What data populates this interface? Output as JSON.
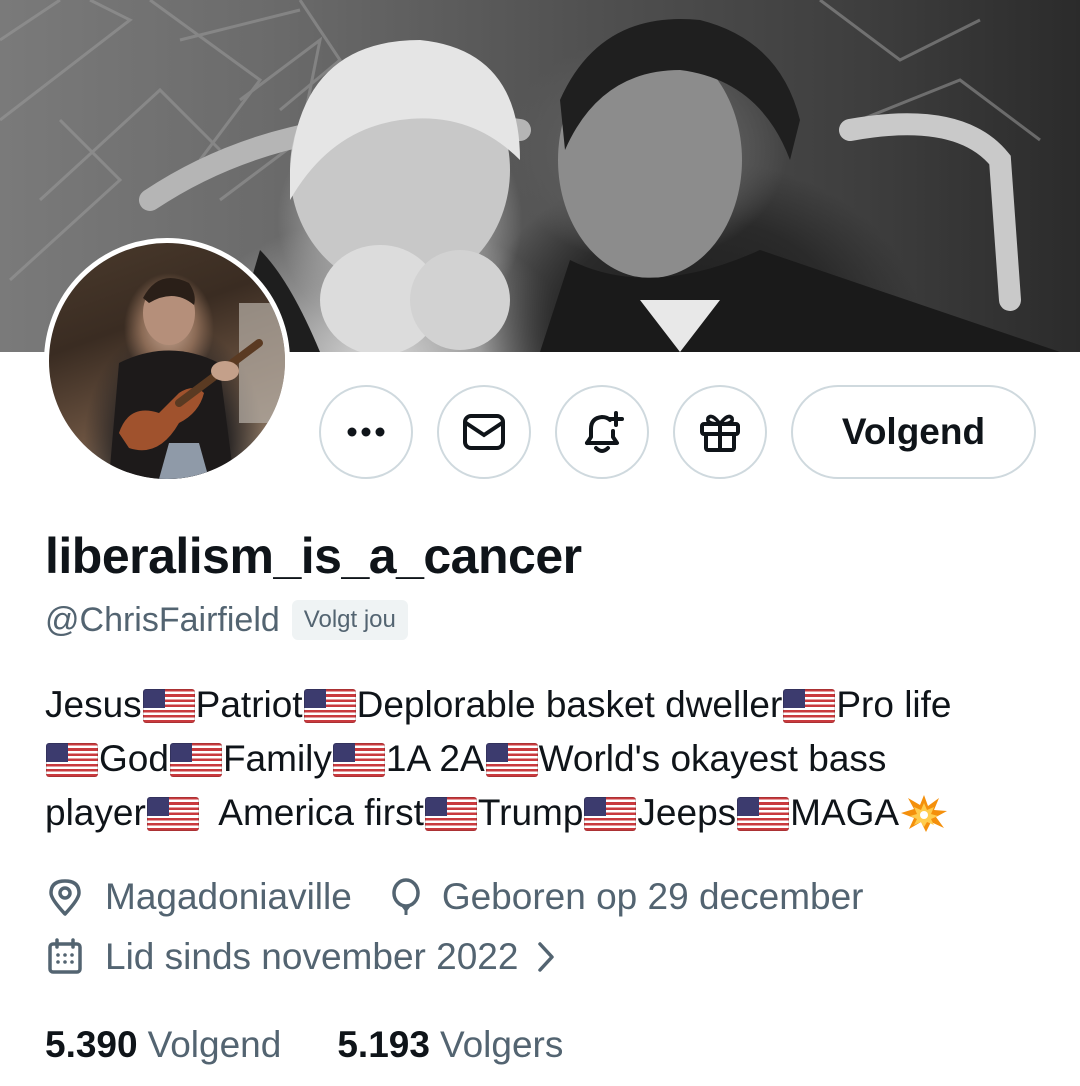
{
  "profile": {
    "display_name": "liberalism_is_a_cancer",
    "handle": "@ChrisFairfield",
    "follows_you": "Volgt jou",
    "bio_segments": [
      {
        "t": "text",
        "v": "Jesus"
      },
      {
        "t": "flag"
      },
      {
        "t": "text",
        "v": "Patriot"
      },
      {
        "t": "flag"
      },
      {
        "t": "text",
        "v": "Deplorable basket dweller"
      },
      {
        "t": "flag"
      },
      {
        "t": "text",
        "v": "Pro life\n"
      },
      {
        "t": "flag"
      },
      {
        "t": "text",
        "v": "God"
      },
      {
        "t": "flag"
      },
      {
        "t": "text",
        "v": "Family"
      },
      {
        "t": "flag"
      },
      {
        "t": "text",
        "v": "1A 2A"
      },
      {
        "t": "flag"
      },
      {
        "t": "text",
        "v": "World's okayest bass\nplayer"
      },
      {
        "t": "flag"
      },
      {
        "t": "text",
        "v": "  America first"
      },
      {
        "t": "flag"
      },
      {
        "t": "text",
        "v": "Trump"
      },
      {
        "t": "flag"
      },
      {
        "t": "text",
        "v": "Jeeps"
      },
      {
        "t": "flag"
      },
      {
        "t": "text",
        "v": "MAGA"
      },
      {
        "t": "boom"
      }
    ],
    "location": "Magadoniaville",
    "birthday": "Geboren op 29 december",
    "joined": "Lid sinds november 2022",
    "following_count": "5.390",
    "following_label": "Volgend",
    "followers_count": "5.193",
    "followers_label": "Volgers"
  },
  "actions": {
    "follow_button_label": "Volgend",
    "icons": [
      "more-icon",
      "message-icon",
      "notification-bell-icon",
      "gift-icon"
    ]
  },
  "colors": {
    "text_primary": "#0f1419",
    "text_secondary": "#536471",
    "border": "#cfd9de",
    "badge_bg": "#eff3f4"
  }
}
